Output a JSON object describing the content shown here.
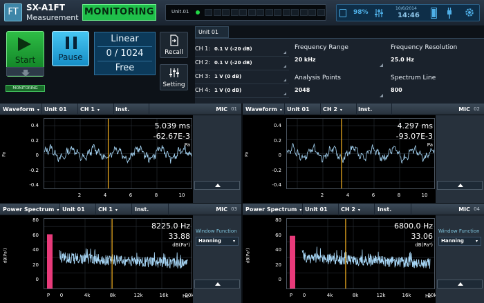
{
  "header": {
    "logo_text": "FT",
    "app_name": "SX-A1FT",
    "app_subtitle": "Measurement",
    "monitoring_label": "MONITORING",
    "unit_label": "Unit.01",
    "battery_percent": "98%",
    "date": "10/6/2014",
    "time": "14:46"
  },
  "controls": {
    "start_label": "Start",
    "pause_label": "Pause",
    "monitoring_tag": "MONITORING",
    "averaging_mode": "Linear",
    "average_count": "0 / 1024",
    "trigger_mode": "Free",
    "recall_label": "Recall",
    "setting_label": "Setting"
  },
  "settings": {
    "unit_tab": "Unit 01",
    "channels": [
      {
        "label": "CH 1:",
        "value": "0.1 V (-20 dB)"
      },
      {
        "label": "CH 2:",
        "value": "0.1 V (-20 dB)"
      },
      {
        "label": "CH 3:",
        "value": "1 V (0 dB)"
      },
      {
        "label": "CH 4:",
        "value": "1 V (0 dB)"
      }
    ],
    "frequency_range": {
      "label": "Frequency Range",
      "value": "20 kHz"
    },
    "frequency_resolution": {
      "label": "Frequency Resolution",
      "value": "25.0 Hz"
    },
    "analysis_points": {
      "label": "Analysis Points",
      "value": "2048"
    },
    "spectrum_line": {
      "label": "Spectrum Line",
      "value": "800"
    }
  },
  "panels": [
    {
      "type": "Waveform",
      "unit": "Unit 01",
      "channel": "CH 1",
      "mode": "Inst.",
      "mic": "MIC",
      "num": "01",
      "readout_main": "5.039 ms",
      "readout_sub": "-62.67E-3",
      "readout_unit": "Pa",
      "y_unit": "Pa",
      "y_ticks": [
        "0.4",
        "0.2",
        "0",
        "-0.2",
        "-0.4"
      ],
      "x_ticks": [
        "2",
        "4",
        "6",
        "8",
        "10"
      ],
      "x_unit": "ms",
      "chart_data": {
        "type": "line",
        "x_range_ms": [
          0,
          11.6
        ],
        "ylim": [
          -0.5,
          0.5
        ],
        "cursor_x_ms": 5.039,
        "cursor_y": -0.06267
      }
    },
    {
      "type": "Waveform",
      "unit": "Unit 01",
      "channel": "CH 2",
      "mode": "Inst.",
      "mic": "MIC",
      "num": "02",
      "readout_main": "4.297 ms",
      "readout_sub": "-93.07E-3",
      "readout_unit": "Pa",
      "y_unit": "Pa",
      "y_ticks": [
        "0.4",
        "0.2",
        "0",
        "-0.2",
        "-0.4"
      ],
      "x_ticks": [
        "2",
        "4",
        "6",
        "8",
        "10"
      ],
      "x_unit": "ms",
      "chart_data": {
        "type": "line",
        "x_range_ms": [
          0,
          11.6
        ],
        "ylim": [
          -0.5,
          0.5
        ],
        "cursor_x_ms": 4.297,
        "cursor_y": -0.09307
      }
    },
    {
      "type": "Power Spectrum",
      "unit": "Unit 01",
      "channel": "CH 1",
      "mode": "Inst.",
      "mic": "MIC",
      "num": "03",
      "readout_main": "8225.0 Hz",
      "readout_sub": "33.88",
      "readout_unit": "dB(Pa²)",
      "y_unit": "dB(Pa²)",
      "window_label": "Window Function",
      "window_value": "Hanning",
      "y_ticks": [
        "80",
        "60",
        "40",
        "20",
        "0"
      ],
      "x_ticks": [
        "P",
        "0",
        "4k",
        "8k",
        "12k",
        "16k",
        "20k"
      ],
      "x_unit": "Hz",
      "chart_data": {
        "type": "line",
        "x_range_hz": [
          0,
          20000
        ],
        "ylim": [
          0,
          90
        ],
        "cursor_x_hz": 8225.0,
        "cursor_y": 33.88,
        "overall_bar_db": 70
      }
    },
    {
      "type": "Power Spectrum",
      "unit": "Unit 01",
      "channel": "CH 2",
      "mode": "Inst.",
      "mic": "MIC",
      "num": "04",
      "readout_main": "6800.0 Hz",
      "readout_sub": "33.06",
      "readout_unit": "dB(Pa²)",
      "y_unit": "dB(Pa²)",
      "window_label": "Window Function",
      "window_value": "Hanning",
      "y_ticks": [
        "80",
        "60",
        "40",
        "20",
        "0"
      ],
      "x_ticks": [
        "P",
        "0",
        "4k",
        "8k",
        "12k",
        "16k",
        "20k"
      ],
      "x_unit": "Hz",
      "chart_data": {
        "type": "line",
        "x_range_hz": [
          0,
          20000
        ],
        "ylim": [
          0,
          90
        ],
        "cursor_x_hz": 6800.0,
        "cursor_y": 33.06,
        "overall_bar_db": 68
      }
    }
  ],
  "colors": {
    "trace": "#a8d8f8",
    "cursor": "#f5b020",
    "overall_bar": "#e83a7a",
    "monitoring": "#1fbf4a",
    "pause": "#2aaee4"
  }
}
